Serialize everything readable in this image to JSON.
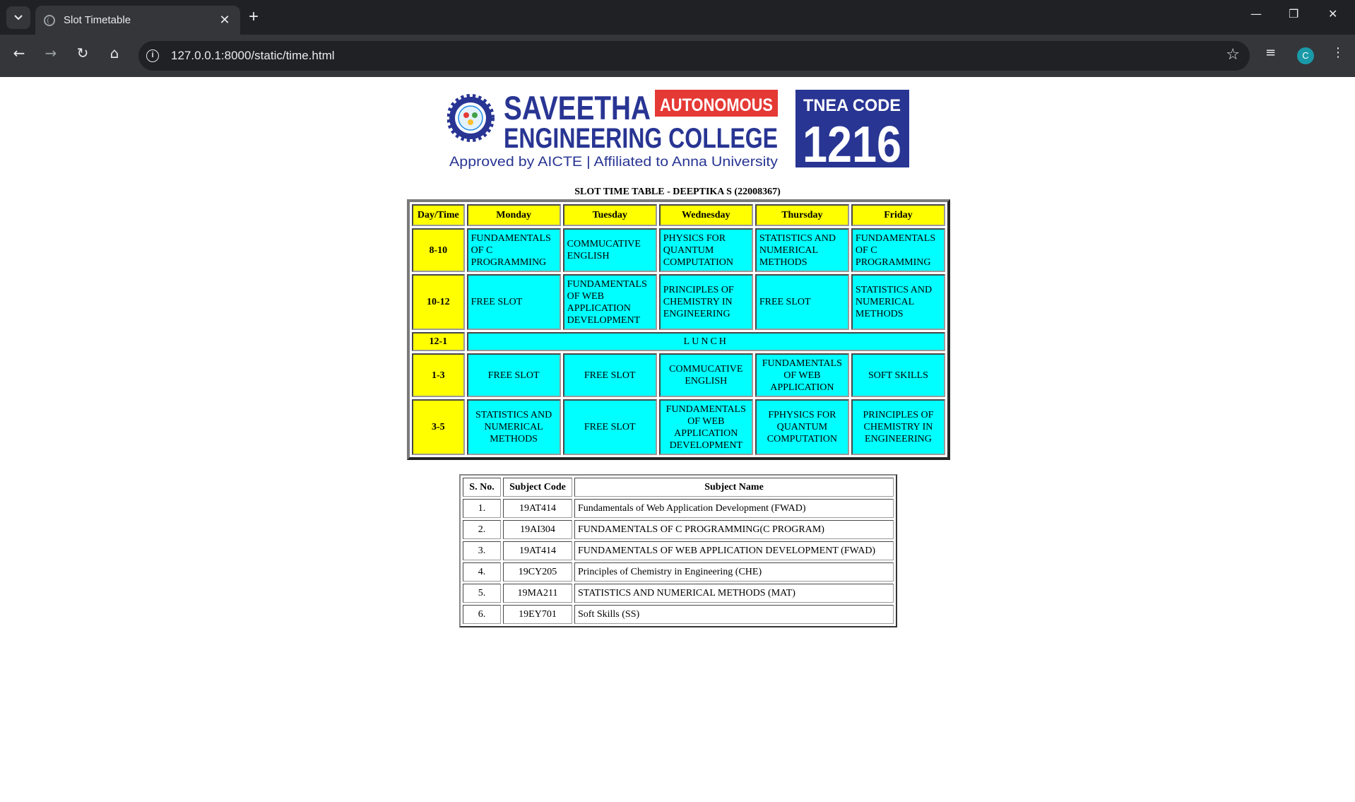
{
  "browser": {
    "tab_title": "Slot Timetable",
    "url": "127.0.0.1:8000/static/time.html",
    "profile_initial": "C",
    "icons": [
      "tab-search-icon",
      "close-icon",
      "new-tab-icon",
      "minimize-icon",
      "restore-icon",
      "window-close-icon",
      "back-icon",
      "forward-icon",
      "reload-icon",
      "home-icon",
      "site-info-icon",
      "bookmark-star-icon",
      "media-icon",
      "menu-icon"
    ]
  },
  "logo": {
    "line1": "SAVEETHA",
    "badge": "AUTONOMOUS",
    "line2": "ENGINEERING COLLEGE",
    "line3": "Approved by AICTE | Affiliated to Anna University",
    "code_label": "TNEA CODE",
    "code_value": "1216",
    "colors": {
      "navy": "#283593",
      "red": "#e53935",
      "white": "#ffffff"
    }
  },
  "page_title": "SLOT TIME TABLE - DEEPTIKA S (22008367)",
  "timetable": {
    "headers": [
      "Day/Time",
      "Monday",
      "Tuesday",
      "Wednesday",
      "Thursday",
      "Friday"
    ],
    "rows": [
      {
        "time": "8-10",
        "cells": [
          "FUNDAMENTALS OF C PROGRAMMING",
          "COMMUCATIVE ENGLISH",
          "PHYSICS FOR QUANTUM COMPUTATION",
          "STATISTICS AND NUMERICAL METHODS",
          "FUNDAMENTALS OF C PROGRAMMING"
        ]
      },
      {
        "time": "10-12",
        "cells": [
          "FREE SLOT",
          "FUNDAMENTALS OF WEB APPLICATION DEVELOPMENT",
          "PRINCIPLES OF CHEMISTRY IN ENGINEERING",
          "FREE SLOT",
          "STATISTICS AND NUMERICAL METHODS"
        ]
      },
      {
        "time": "12-1",
        "lunch": "LUNCH"
      },
      {
        "time": "1-3",
        "cells": [
          "FREE SLOT",
          "FREE SLOT",
          "COMMUCATIVE ENGLISH",
          "FUNDAMENTALS OF WEB APPLICATION",
          "SOFT SKILLS"
        ]
      },
      {
        "time": "3-5",
        "cells": [
          "STATISTICS AND NUMERICAL METHODS",
          "FREE SLOT",
          "FUNDAMENTALS OF WEB APPLICATION DEVELOPMENT",
          "FPHYSICS FOR QUANTUM COMPUTATION",
          "PRINCIPLES OF CHEMISTRY IN ENGINEERING"
        ]
      }
    ],
    "colors": {
      "header_bg": "#ffff00",
      "cell_bg": "#00ffff"
    }
  },
  "subjects": {
    "headers": [
      "S. No.",
      "Subject Code",
      "Subject Name"
    ],
    "rows": [
      [
        "1.",
        "19AT414",
        "Fundamentals of Web Application Development (FWAD)"
      ],
      [
        "2.",
        "19AI304",
        "FUNDAMENTALS OF C PROGRAMMING(C PROGRAM)"
      ],
      [
        "3.",
        "19AT414",
        "FUNDAMENTALS OF WEB APPLICATION DEVELOPMENT (FWAD)"
      ],
      [
        "4.",
        "19CY205",
        "Principles of Chemistry in Engineering (CHE)"
      ],
      [
        "5.",
        "19MA211",
        "STATISTICS AND NUMERICAL METHODS (MAT)"
      ],
      [
        "6.",
        "19EY701",
        "Soft Skills (SS)"
      ]
    ]
  }
}
